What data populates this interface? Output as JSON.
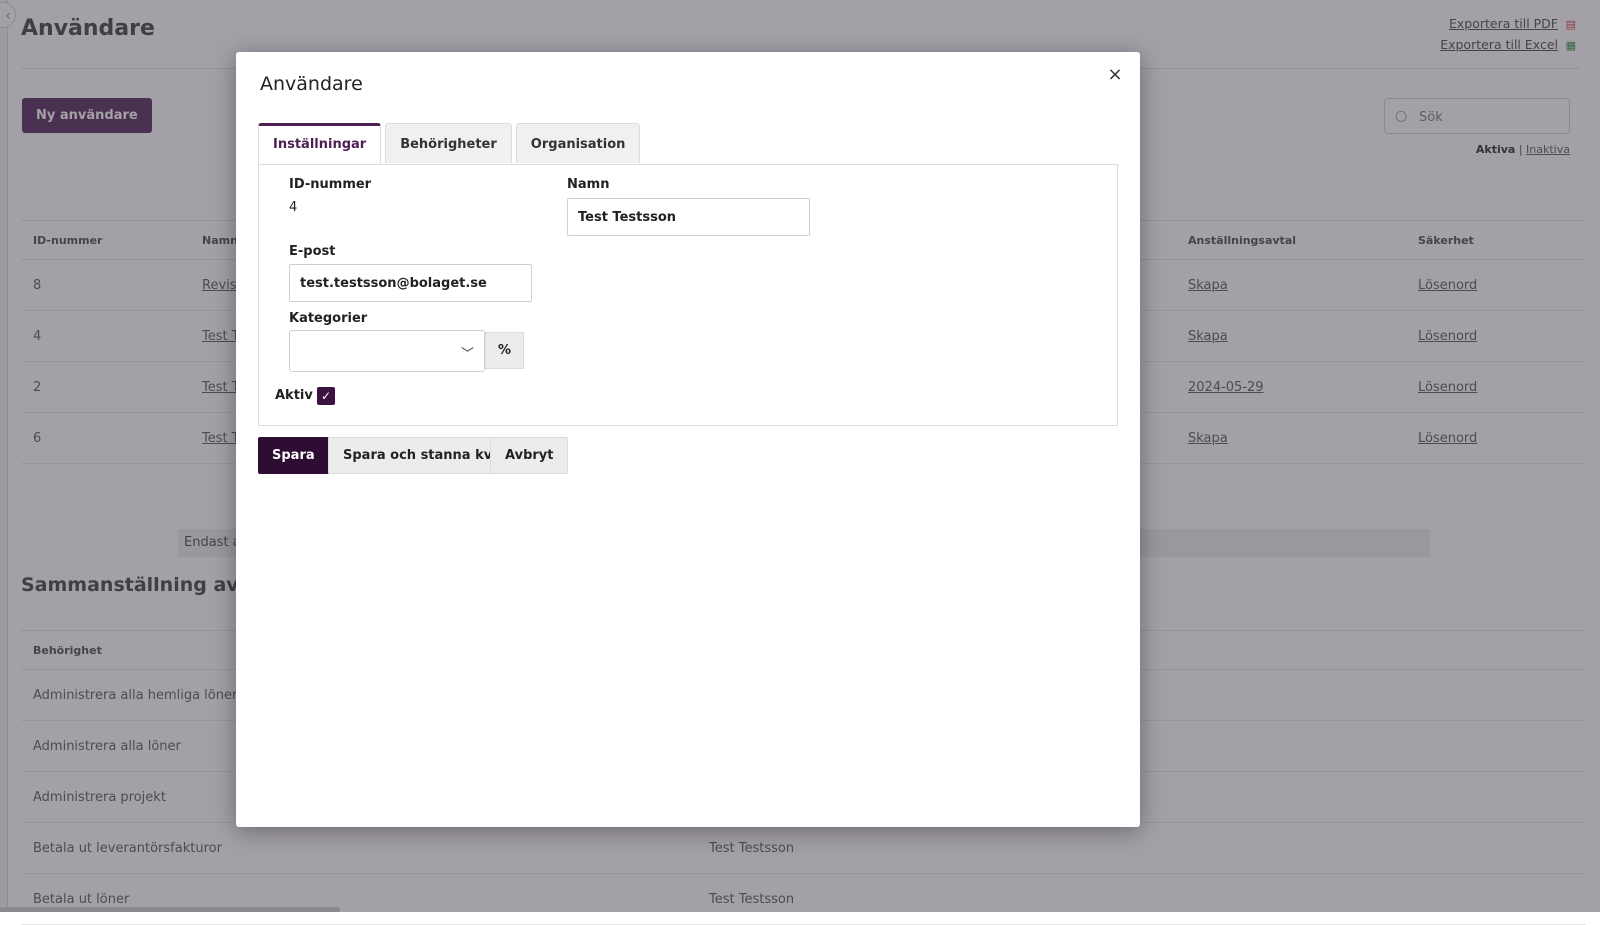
{
  "page": {
    "title": "Användare",
    "export_pdf": "Exportera till PDF",
    "export_excel": "Exportera till Excel",
    "new_user_button": "Ny användare",
    "search_placeholder": "Sök",
    "filter_active": "Aktiva",
    "filter_separator": "|",
    "filter_inactive": "Inaktiva",
    "users_table": {
      "headers": [
        "ID-nummer",
        "Namn",
        "Anställningsavtal",
        "Säkerhet"
      ],
      "rows": [
        {
          "id": "8",
          "name": "Revis",
          "contract": "Skapa",
          "security": "Lösenord"
        },
        {
          "id": "4",
          "name": "Test T",
          "contract": "Skapa",
          "security": "Lösenord"
        },
        {
          "id": "2",
          "name": "Test T",
          "contract": "2024-05-29",
          "security": "Lösenord"
        },
        {
          "id": "6",
          "name": "Test T",
          "contract": "Skapa",
          "security": "Lösenord"
        }
      ]
    },
    "info_text": "Endast ak",
    "summary_title": "Sammanställning av behö",
    "perm_table": {
      "header": "Behörighet",
      "rows": [
        {
          "permission": "Administrera alla hemliga löner",
          "user": ""
        },
        {
          "permission": "Administrera alla löner",
          "user": ""
        },
        {
          "permission": "Administrera projekt",
          "user": ""
        },
        {
          "permission": "Betala ut leverantörsfakturor",
          "user": "Test Testsson"
        },
        {
          "permission": "Betala ut löner",
          "user": "Test Testsson"
        }
      ]
    }
  },
  "modal": {
    "title": "Användare",
    "close_symbol": "×",
    "tabs": [
      {
        "label": "Inställningar",
        "active": true
      },
      {
        "label": "Behörigheter",
        "active": false
      },
      {
        "label": "Organisation",
        "active": false
      }
    ],
    "id_label": "ID-nummer",
    "id_value": "4",
    "name_label": "Namn",
    "name_value": "Test Testsson",
    "email_label": "E-post",
    "email_value": "test.testsson@bolaget.se",
    "categories_label": "Kategorier",
    "categories_value": "",
    "percent_button": "%",
    "active_label": "Aktiv",
    "active_checked": true,
    "buttons": {
      "save": "Spara",
      "save_stay": "Spara och stanna kvar",
      "cancel": "Avbryt"
    }
  },
  "colors": {
    "brand_purple": "#4d1f52",
    "primary_dark": "#2e0c33",
    "overlay": "#484250"
  },
  "icons": [
    "chevron-left-icon",
    "pdf-icon",
    "excel-icon",
    "search-icon",
    "close-icon",
    "chevron-down-icon",
    "check-icon"
  ]
}
